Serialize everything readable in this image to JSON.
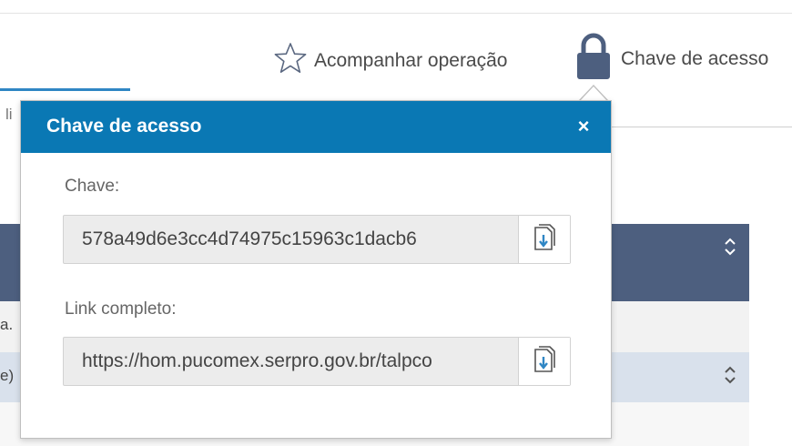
{
  "actions": {
    "follow_label": "Acompanhar operação",
    "key_label": "Chave de acesso"
  },
  "background": {
    "tab_text": "li",
    "row1_text": "a.",
    "row2_text": "e)"
  },
  "popover": {
    "title": "Chave de acesso",
    "close_icon": "×",
    "key_label": "Chave:",
    "key_value": "578a49d6e3cc4d74975c15963c1dacb6",
    "link_label": "Link completo:",
    "link_value": "https://hom.pucomex.serpro.gov.br/talpco"
  },
  "colors": {
    "header_blue": "#0a78b4",
    "table_header": "#4d5f7f",
    "row_highlight": "#d9e1ec"
  }
}
